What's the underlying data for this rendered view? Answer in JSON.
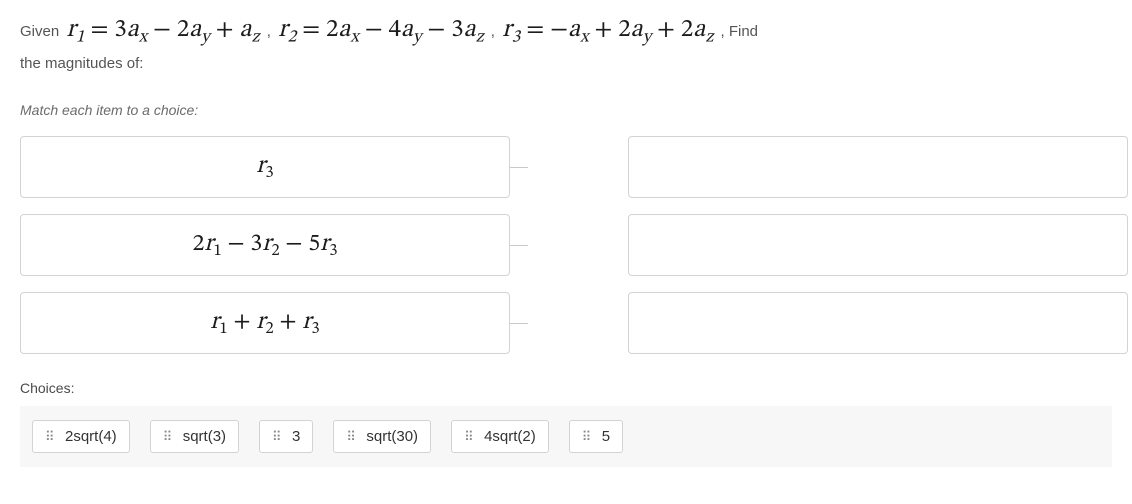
{
  "question": {
    "given_label": "Given",
    "find_label": ", Find",
    "subtitle": "the magnitudes of:",
    "instruction": "Match each item to a choice:",
    "vectors": {
      "r1": "r₁ = 3aₓ − 2a_y + a_z",
      "r2": "r₂ = 2aₓ − 4a_y − 3a_z",
      "r3": "r₃ = −aₓ + 2a_y + 2a_z"
    }
  },
  "items": {
    "0": "r₃",
    "1": "2r₁ − 3r₂ − 5r₃",
    "2": "r₁ + r₂ + r₃"
  },
  "choices": {
    "0": "2sqrt(4)",
    "1": "sqrt(3)",
    "2": "3",
    "3": "sqrt(30)",
    "4": "4sqrt(2)",
    "5": "5"
  },
  "choices_label": "Choices:"
}
